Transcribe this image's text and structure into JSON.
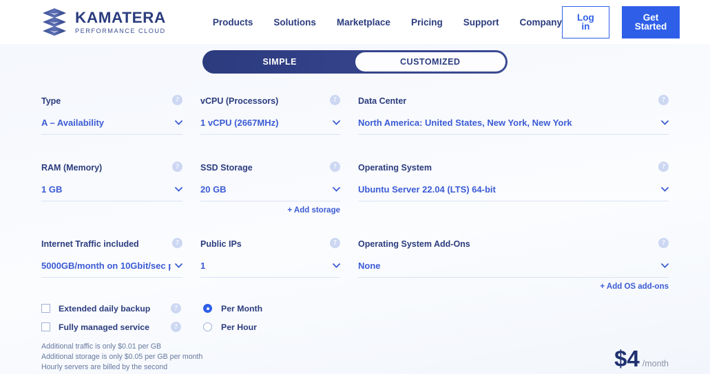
{
  "header": {
    "logo": {
      "name": "KAMATERA",
      "tagline": "PERFORMANCE CLOUD",
      "icon": "kamatera-stacked-diamond-logo"
    },
    "nav": [
      {
        "label": "Products"
      },
      {
        "label": "Solutions"
      },
      {
        "label": "Marketplace"
      },
      {
        "label": "Pricing"
      },
      {
        "label": "Support"
      },
      {
        "label": "Company"
      }
    ],
    "login_label": "Log in",
    "get_started_label": "Get Started"
  },
  "mode_toggle": {
    "simple_label": "SIMPLE",
    "customized_label": "CUSTOMIZED",
    "selected": "SIMPLE"
  },
  "fields": {
    "type": {
      "label": "Type",
      "value": "A – Availability",
      "help": "?"
    },
    "vcpu": {
      "label": "vCPU (Processors)",
      "value": "1 vCPU (2667MHz)",
      "help": "?"
    },
    "datacenter": {
      "label": "Data Center",
      "value": "North America: United States, New York, New York",
      "help": "?"
    },
    "ram": {
      "label": "RAM (Memory)",
      "value": "1 GB",
      "help": "?"
    },
    "ssd": {
      "label": "SSD Storage",
      "value": "20 GB",
      "help": "?",
      "add_link": "+ Add storage"
    },
    "os": {
      "label": "Operating System",
      "value": "Ubuntu Server 22.04 (LTS) 64-bit",
      "help": "?"
    },
    "traffic": {
      "label": "Internet Traffic included",
      "value": "5000GB/month on 10Gbit/sec p",
      "help": "?"
    },
    "public_ips": {
      "label": "Public IPs",
      "value": "1",
      "help": "?"
    },
    "os_addons": {
      "label": "Operating System Add-Ons",
      "value": "None",
      "help": "?",
      "add_link": "+ Add OS add-ons"
    }
  },
  "options": {
    "checkboxes": [
      {
        "label": "Extended daily backup",
        "checked": false,
        "help": "?"
      },
      {
        "label": "Fully managed service",
        "checked": false,
        "help": "?"
      }
    ],
    "billing": [
      {
        "label": "Per Month",
        "selected": true
      },
      {
        "label": "Per Hour",
        "selected": false
      }
    ]
  },
  "notes": [
    "Additional traffic is only $0.01 per GB",
    "Additional storage is only $0.05 per GB per month",
    "Hourly servers are billed by the second"
  ],
  "price": {
    "amount": "$4",
    "period": "/month"
  },
  "colors": {
    "brand_navy": "#2b3c7e",
    "accent_blue": "#2f5fe8",
    "value_blue": "#3b5bd4",
    "underline": "#dbe2f5",
    "help_bubble": "#ccd7f2"
  }
}
